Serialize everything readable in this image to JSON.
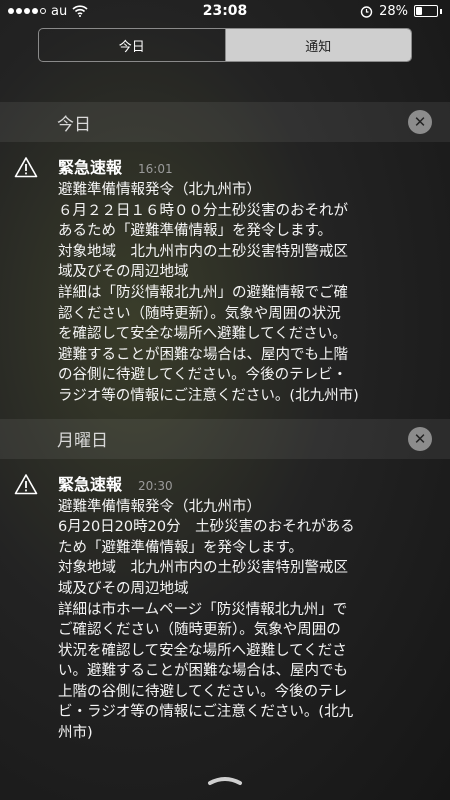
{
  "status_bar": {
    "carrier": "au",
    "time": "23:08",
    "battery_percent": "28%",
    "battery_level": 0.28,
    "signal_bars": 4
  },
  "segmented_control": {
    "today": "今日",
    "notifications": "通知"
  },
  "sections": [
    {
      "title": "今日",
      "notification": {
        "app_title": "緊急速報",
        "time": "16:01",
        "text": "避難準備情報発令（北九州市）\n６月２２日１６時００分土砂災害のおそれが\nあるため「避難準備情報」を発令します。\n対象地域　北九州市内の土砂災害特別警戒区\n域及びその周辺地域\n詳細は「防災情報北九州」の避難情報でご確\n認ください（随時更新）。気象や周囲の状況\nを確認して安全な場所へ避難してください。\n避難することが困難な場合は、屋内でも上階\nの谷側に待避してください。今後のテレビ・\nラジオ等の情報にご注意ください。(北九州市)"
      }
    },
    {
      "title": "月曜日",
      "notification": {
        "app_title": "緊急速報",
        "time": "20:30",
        "text": "避難準備情報発令（北九州市）\n6月20日20時20分　土砂災害のおそれがある\nため「避難準備情報」を発令します。\n対象地域　北九州市内の土砂災害特別警戒区\n域及びその周辺地域\n詳細は市ホームページ「防災情報北九州」で\nご確認ください（随時更新）。気象や周囲の\n状況を確認して安全な場所へ避難してくださ\nい。避難することが困難な場合は、屋内でも\n上階の谷側に待避してください。今後のテレ\nビ・ラジオ等の情報にご注意ください。(北九\n州市)"
      }
    }
  ],
  "icons": {
    "warning": "warning-icon",
    "close": "close-icon",
    "alarm": "alarm-icon",
    "wifi": "wifi-icon",
    "battery": "battery-icon",
    "grabber": "chevron-grabber-icon"
  }
}
